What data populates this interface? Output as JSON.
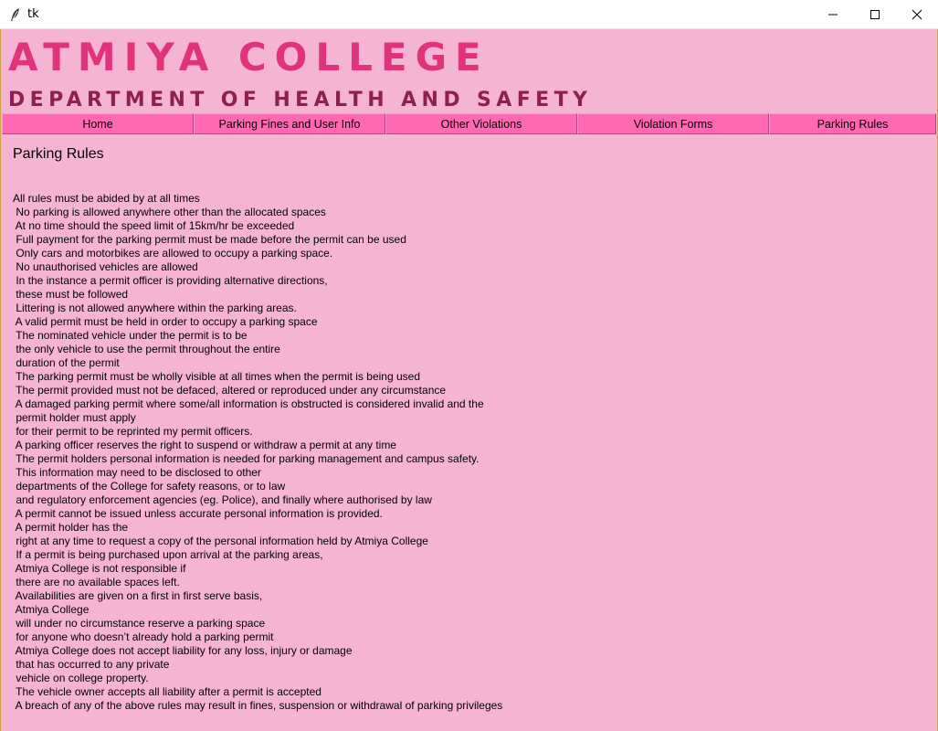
{
  "window": {
    "title": "tk",
    "app_icon": "feather-icon",
    "controls": [
      "minimize-icon",
      "maximize-icon",
      "close-icon"
    ]
  },
  "header": {
    "college_name": "ATMIYA COLLEGE",
    "department": "DEPARTMENT OF HEALTH AND SAFETY"
  },
  "nav": {
    "items": [
      {
        "label": "Home"
      },
      {
        "label": "Parking Fines and User Info"
      },
      {
        "label": "Other Violations"
      },
      {
        "label": "Violation Forms"
      },
      {
        "label": "Parking Rules"
      }
    ]
  },
  "content": {
    "heading": "Parking Rules",
    "lines": [
      "All rules must be abided by at all times",
      " No parking is allowed anywhere other than the allocated spaces",
      " At no time should the speed limit of 15km/hr be exceeded",
      " Full payment for the parking permit must be made before the permit can be used",
      " Only cars and motorbikes are allowed to occupy a parking space.",
      " No unauthorised vehicles are allowed",
      " In the instance a permit officer is providing alternative directions,",
      " these must be followed",
      " Littering is not allowed anywhere within the parking areas.",
      " A valid permit must be held in order to occupy a parking space",
      " The nominated vehicle under the permit is to be",
      " the only vehicle to use the permit throughout the entire",
      " duration of the permit",
      " The parking permit must be wholly visible at all times when the permit is being used",
      " The permit provided must not be defaced, altered or reproduced under any circumstance",
      " A damaged parking permit where some/all information is obstructed is considered invalid and the",
      " permit holder must apply",
      " for their permit to be reprinted my permit officers.",
      " A parking officer reserves the right to suspend or withdraw a permit at any time",
      " The permit holders personal information is needed for parking management and campus safety.",
      " This information may need to be disclosed to other",
      " departments of the College for safety reasons, or to law",
      " and regulatory enforcement agencies (eg. Police), and finally where authorised by law",
      " A permit cannot be issued unless accurate personal information is provided.",
      " A permit holder has the",
      " right at any time to request a copy of the personal information held by Atmiya College",
      " If a permit is being purchased upon arrival at the parking areas,",
      " Atmiya College is not responsible if",
      " there are no available spaces left.",
      " Availabilities are given on a first in first serve basis,",
      " Atmiya College",
      " will under no circumstance reserve a parking space",
      " for anyone who doesn’t already hold a parking permit",
      " Atmiya College does not accept liability for any loss, injury or damage",
      " that has occurred to any private",
      " vehicle on college property.",
      " The vehicle owner accepts all liability after a permit is accepted",
      " A breach of any of the above rules may result in fines, suspension or withdrawal of parking privileges"
    ]
  },
  "colors": {
    "background": "#f6b4d3",
    "nav_button": "#ff69b4",
    "title": "#e0337c",
    "subtitle": "#8e1f4f"
  }
}
